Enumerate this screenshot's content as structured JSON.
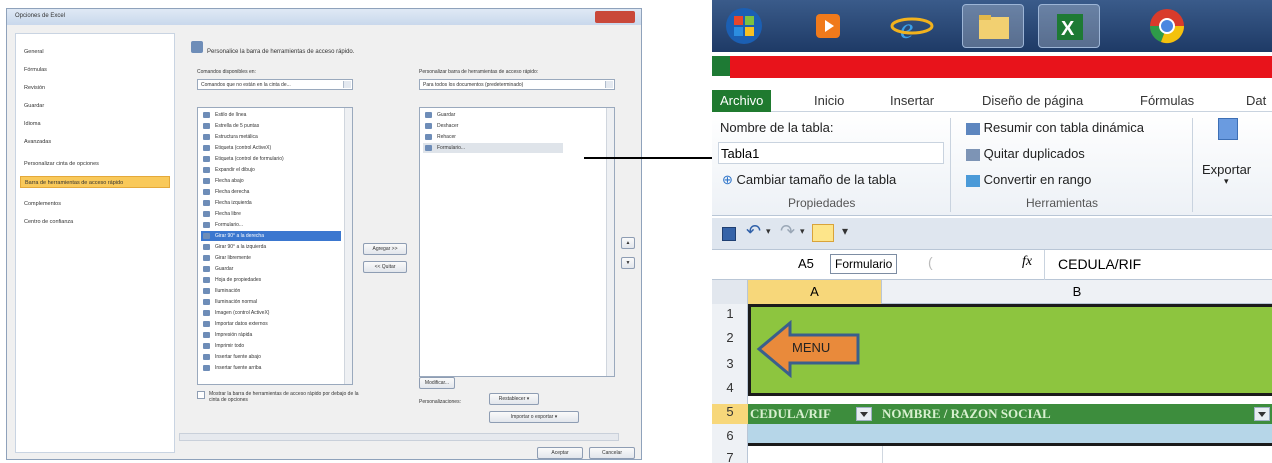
{
  "dialog": {
    "title": "Opciones de Excel",
    "nav": [
      "General",
      "Fórmulas",
      "Revisión",
      "Guardar",
      "Idioma",
      "Avanzadas",
      "Personalizar cinta de opciones",
      "Barra de herramientas de acceso rápido",
      "Complementos",
      "Centro de confianza"
    ],
    "heading": "Personalice la barra de herramientas de acceso rápido.",
    "choose_label": "Comandos disponibles en:",
    "choose_value": "Comandos que no están en la cinta de...",
    "customize_label": "Personalizar barra de herramientas de acceso rápido:",
    "customize_value": "Para todos los documentos (predeterminado)",
    "commands": [
      "Estilo de línea",
      "Estrella de 5 puntas",
      "Estructura metálica",
      "Etiqueta (control ActiveX)",
      "Etiqueta (control de formulario)",
      "Expandir el dibujo",
      "Flecha abajo",
      "Flecha derecha",
      "Flecha izquierda",
      "Flecha libre",
      "Formulario...",
      "Girar 90° a la derecha",
      "Girar 90° a la izquierda",
      "Girar libremente",
      "Guardar",
      "Hoja de propiedades",
      "Iluminación",
      "Iluminación normal",
      "Imagen (control ActiveX)",
      "Importar datos externos",
      "Impresión rápida",
      "Imprimir todo",
      "Insertar fuente abajo",
      "Insertar fuente arriba"
    ],
    "qat_items": [
      "Guardar",
      "Deshacer",
      "Rehacer",
      "Formulario..."
    ],
    "add_button": "Agregar >>",
    "remove_button": "<< Quitar",
    "modify_button": "Modificar...",
    "checkbox_text": "Mostrar la barra de herramientas de acceso rápido por debajo de la cinta de opciones",
    "custom_label": "Personalizaciones:",
    "restore_button": "Restablecer ▾",
    "import_button": "Importar o exportar ▾",
    "ok_button": "Aceptar",
    "cancel_button": "Cancelar"
  },
  "excel": {
    "tabs": [
      "Archivo",
      "Inicio",
      "Insertar",
      "Diseño de página",
      "Fórmulas",
      "Dat"
    ],
    "table_name_label": "Nombre de la tabla:",
    "table_name_value": "Tabla1",
    "resize": "Cambiar tamaño de la tabla",
    "properties_group": "Propiedades",
    "summarize": "Resumir con tabla dinámica",
    "remove_dups": "Quitar duplicados",
    "convert": "Convertir en rango",
    "tools_group": "Herramientas",
    "export": "Exportar",
    "name_box": "A5",
    "tooltip": "Formulario",
    "fx": "fx",
    "formula": "CEDULA/RIF",
    "col_a": "A",
    "col_b": "B",
    "rows": [
      "1",
      "2",
      "3",
      "4",
      "5",
      "6",
      "7"
    ],
    "menu_label": "MENU",
    "header_cedula": "CEDULA/RIF",
    "header_nombre": "NOMBRE / RAZON SOCIAL"
  }
}
